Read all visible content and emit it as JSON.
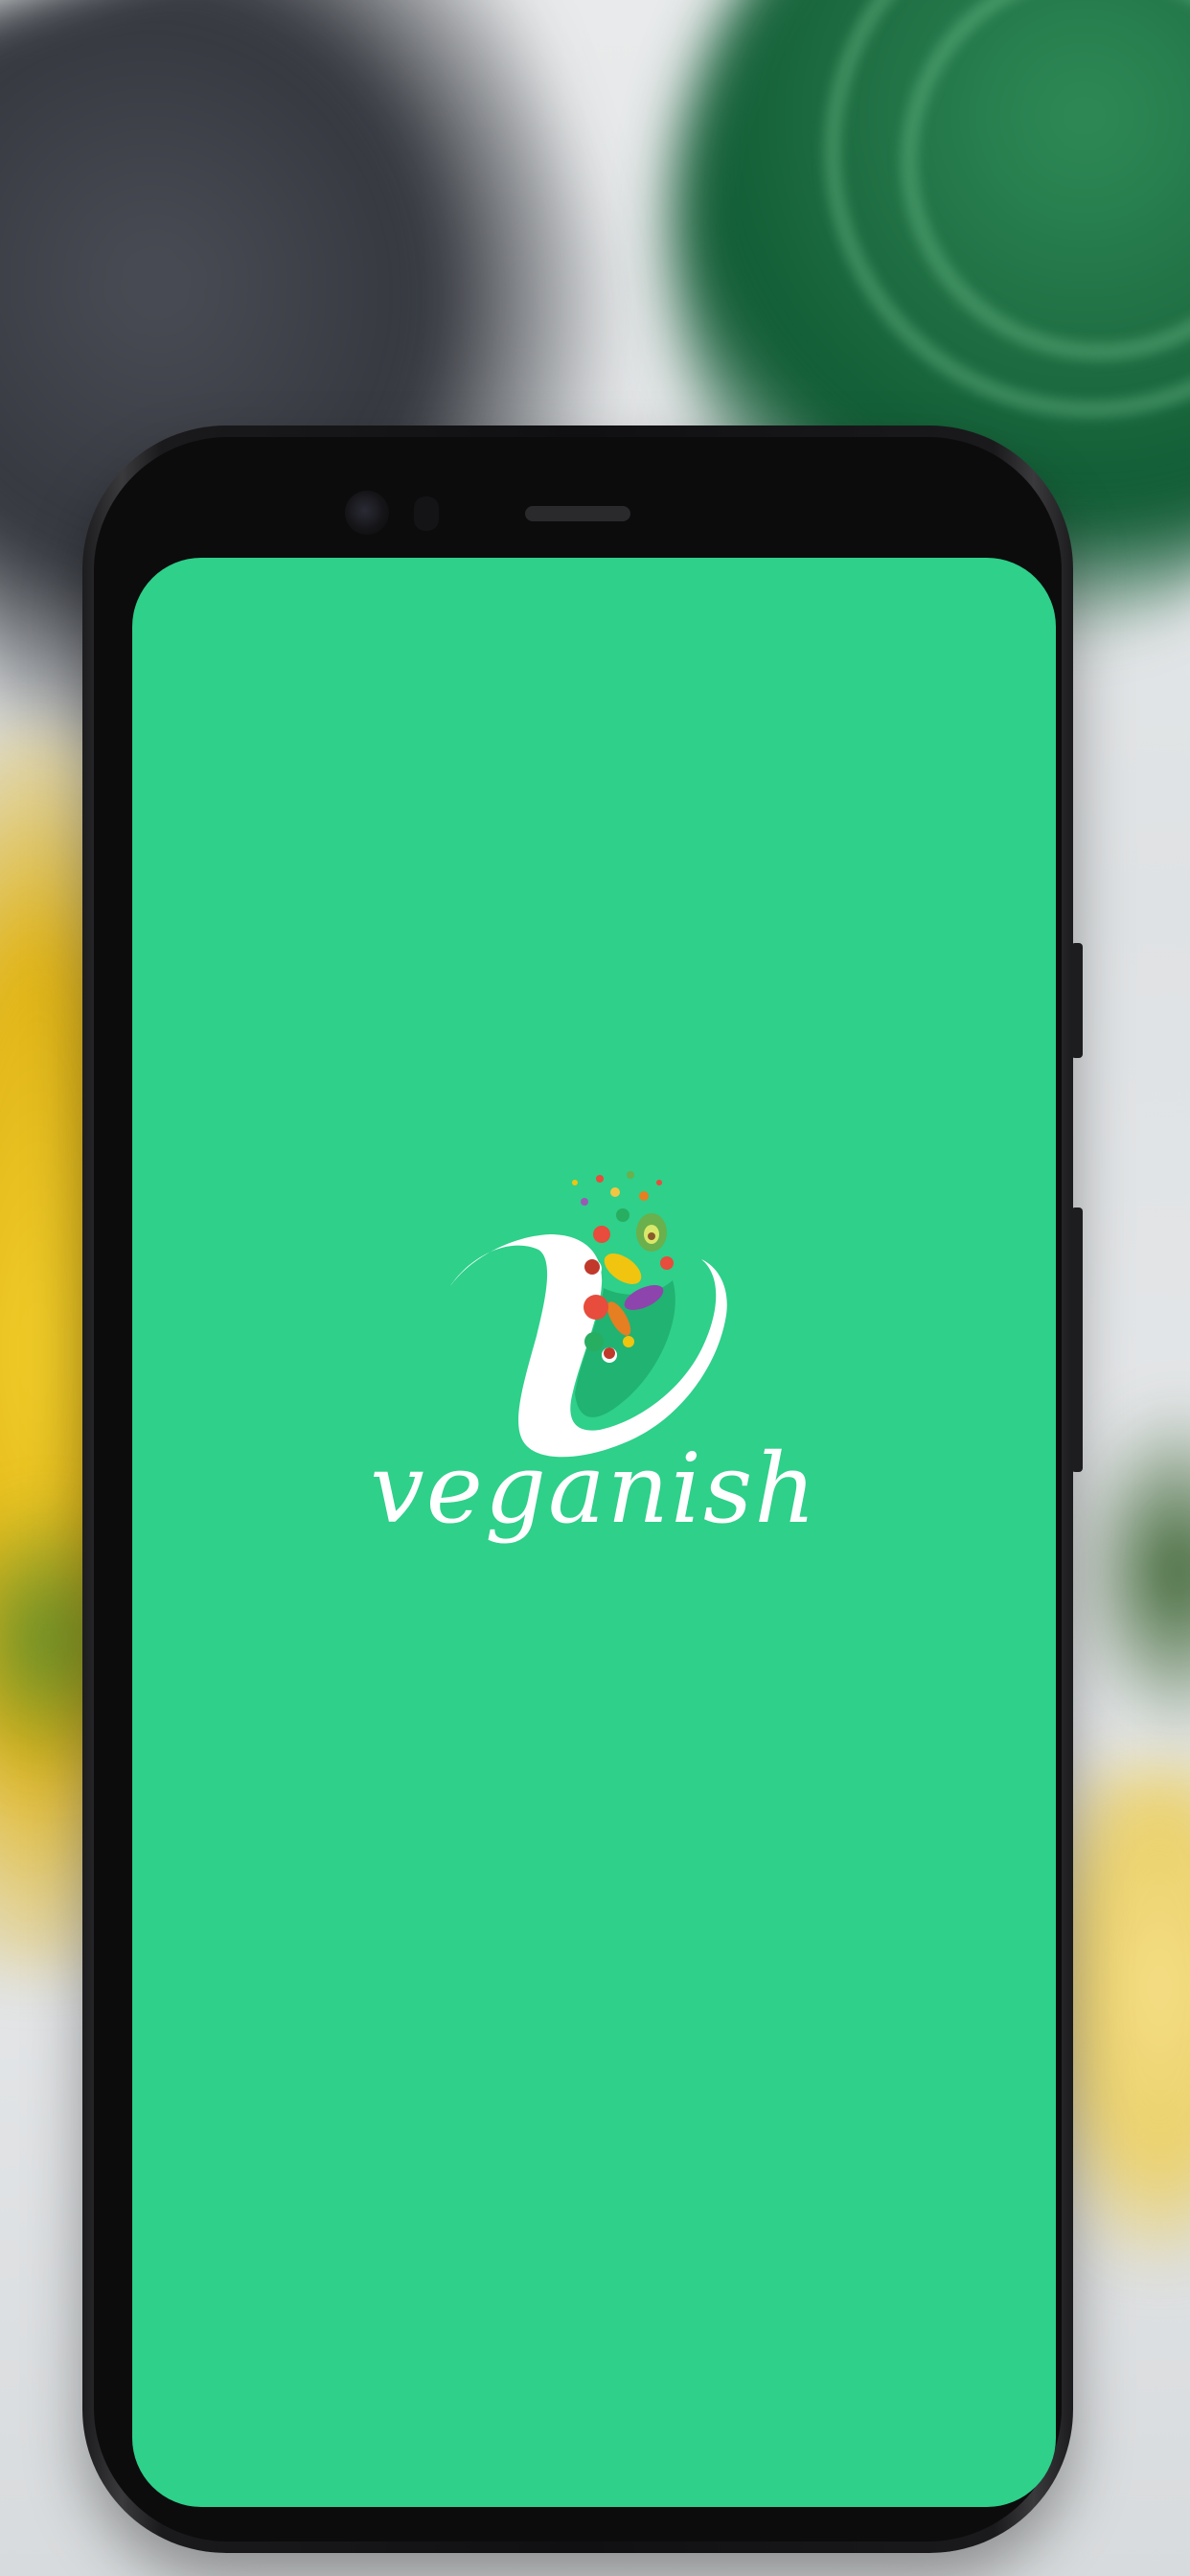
{
  "app": {
    "brand_name": "veganish",
    "background_color": "#2ed08a",
    "logo_icon": "veganish-v-vegetables-logo"
  },
  "device": {
    "type": "android-phone",
    "frame_color": "#101012"
  }
}
